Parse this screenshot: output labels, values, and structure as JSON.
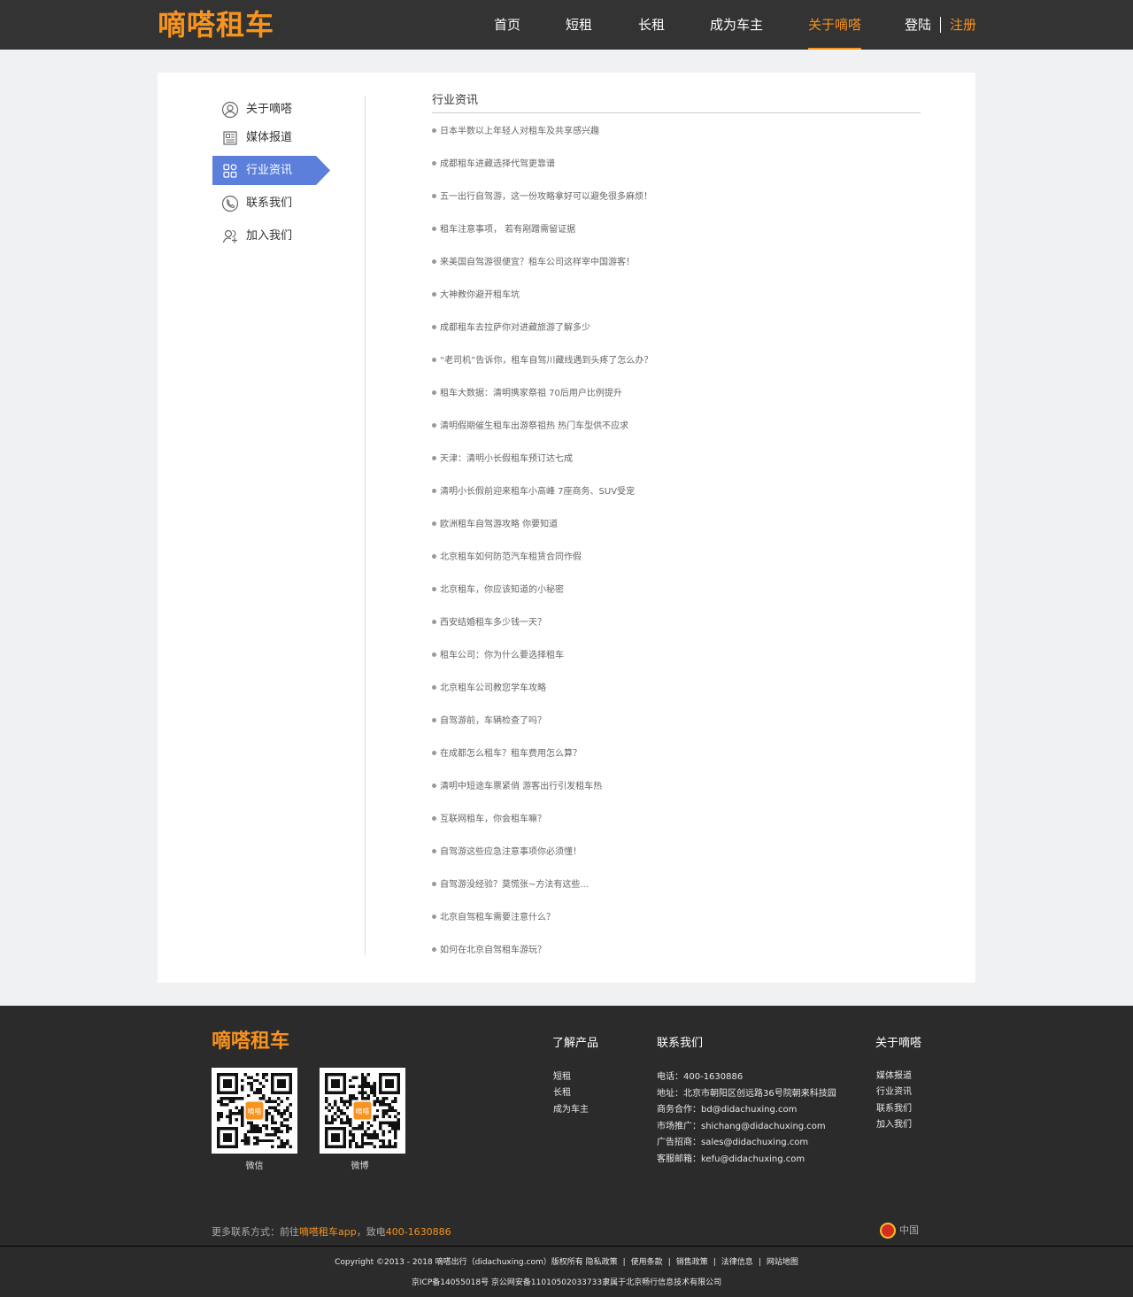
{
  "header": {
    "logo": "嘀嗒租车",
    "nav": [
      "首页",
      "短租",
      "长租",
      "成为车主",
      "关于嘀嗒"
    ],
    "active_nav": "关于嘀嗒",
    "login": "登陆",
    "register": "注册",
    "accent_color": "#f7931e"
  },
  "sidebar": {
    "items": [
      {
        "label": "关于嘀嗒",
        "icon": "user-circle-icon"
      },
      {
        "label": "媒体报道",
        "icon": "newspaper-icon"
      },
      {
        "label": "行业资讯",
        "icon": "grid-icon"
      },
      {
        "label": "联系我们",
        "icon": "phone-icon"
      },
      {
        "label": "加入我们",
        "icon": "add-user-icon"
      }
    ],
    "active": "行业资讯",
    "active_color": "#5b7fdb"
  },
  "main": {
    "title": "行业资讯",
    "news": [
      "日本半数以上年轻人对租车及共享感兴趣",
      "成都租车进藏选择代驾更靠谱",
      "五一出行自驾游，这一份攻略拿好可以避免很多麻烦！",
      "租车注意事项， 若有剐蹭需留证据",
      "来美国自驾游很便宜？租车公司这样宰中国游客！",
      "大神教你避开租车坑",
      "成都租车去拉萨你对进藏旅游了解多少",
      "“老司机”告诉你，租车自驾川藏线遇到头疼了怎么办？",
      "租车大数据：清明携家祭祖 70后用户比例提升",
      "清明假期催生租车出游祭祖热 热门车型供不应求",
      "天津：清明小长假租车预订达七成",
      "清明小长假前迎来租车小高峰 7座商务、SUV受宠",
      "欧洲租车自驾游攻略 你要知道",
      "北京租车如何防范汽车租赁合同作假",
      "北京租车，你应该知道的小秘密",
      "西安结婚租车多少钱一天？",
      "租车公司：你为什么要选择租车",
      "北京租车公司教您学车攻略",
      "自驾游前，车辆检查了吗？",
      "在成都怎么租车？租车费用怎么算？",
      "清明中短途车票紧俏 游客出行引发租车热",
      "互联网租车，你会租车嘛？",
      "自驾游这些应急注意事项你必须懂！",
      "自驾游没经验？莫慌张~方法有这些...",
      "北京自驾租车需要注意什么？",
      "如何在北京自驾租车游玩？"
    ]
  },
  "footer": {
    "logo": "嘀嗒租车",
    "qr": [
      {
        "label": "微信",
        "center": "嘀嗒"
      },
      {
        "label": "微博",
        "center": "嘀嗒"
      }
    ],
    "products": {
      "title": "了解产品",
      "links": [
        "短租",
        "长租",
        "成为车主"
      ]
    },
    "contact": {
      "title": "联系我们",
      "lines": [
        "电话：400-1630886",
        "地址：北京市朝阳区创远路36号院朝来科技园",
        "商务合作：bd@didachuxing.com",
        "市场推广：shichang@didachuxing.com",
        "广告招商：sales@didachuxing.com",
        "客服邮箱：kefu@didachuxing.com"
      ]
    },
    "about": {
      "title": "关于嘀嗒",
      "links": [
        "媒体报道",
        "行业资讯",
        "联系我们",
        "加入我们"
      ]
    },
    "more": {
      "prefix": "更多联系方式：前往",
      "app": "嘀嗒租车app",
      "mid": "，致电",
      "phone": "400-1630886"
    },
    "region": "中国",
    "copyright": "Copyright ©2013 - 2018 嘀嗒出行（didachuxing.com）版权所有",
    "policy_links": [
      "隐私政策",
      "使用条款",
      "销售政策",
      "法律信息",
      "网站地图"
    ],
    "icp": "京ICP备14055018号 京公网安备11010502033733隶属于北京畅行信息技术有限公司"
  }
}
